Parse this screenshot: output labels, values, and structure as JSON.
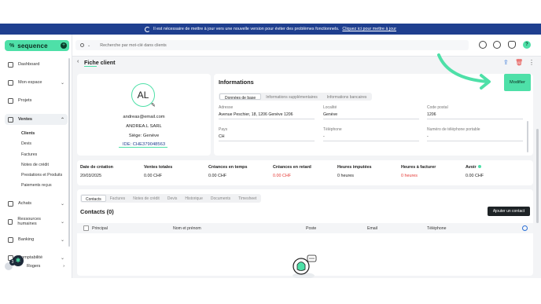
{
  "banner": {
    "text": "Il est nécessaire de mettre à jour vers une nouvelle version pour éviter des problèmes fonctionnels.",
    "link": "Cliquez ici pour mettre à jour"
  },
  "brand": {
    "name": "sequence",
    "mark": "%"
  },
  "sidebar": {
    "items": [
      {
        "label": "Dashboard",
        "icon": "home-icon"
      },
      {
        "label": "Mon espace",
        "icon": "user-icon"
      },
      {
        "label": "Projets",
        "icon": "checkbox-icon"
      },
      {
        "label": "Ventes",
        "icon": "flame-icon"
      },
      {
        "label": "Achats",
        "icon": "cart-icon"
      },
      {
        "label": "Ressources humaines",
        "icon": "people-icon"
      },
      {
        "label": "Banking",
        "icon": "bank-icon"
      },
      {
        "label": "Comptabilité",
        "icon": "calculator-icon"
      }
    ],
    "sub_items": [
      "Clients",
      "Devis",
      "Factures",
      "Notes de crédit",
      "Prestations et Produits",
      "Paiements reçus"
    ],
    "user_name": "Rogers",
    "badge": "3"
  },
  "topbar": {
    "search_placeholder": "Recherche par mot-clé dans clients",
    "help": "?"
  },
  "page": {
    "title": "Fiche client",
    "back": "‹"
  },
  "profile": {
    "initials": "AL",
    "email": "andreas@email.com",
    "company": "ANDREA.L SARL",
    "siege": "Siège: Genève",
    "ide": "IDE: CHE379048563"
  },
  "info": {
    "title": "Informations",
    "modify_label": "Modifier",
    "tabs": [
      "Données de base",
      "Informations supplémentaires",
      "Informations bancaires"
    ],
    "fields": {
      "adresse_label": "Adresse",
      "adresse_value": "Avenue Peschier, 18, 1206 Genève 1206",
      "localite_label": "Localité",
      "localite_value": "Genève",
      "code_postal_label": "Code postal",
      "code_postal_value": "1206",
      "pays_label": "Pays",
      "pays_value": "CH",
      "telephone_label": "Téléphone",
      "telephone_value": "-",
      "portable_label": "Numéro de téléphone portable",
      "portable_value": "-"
    }
  },
  "stats": [
    {
      "label": "Date de création",
      "value": "20/03/2025"
    },
    {
      "label": "Ventes totales",
      "value": "0.00 CHF"
    },
    {
      "label": "Créances en temps",
      "value": "0.00 CHF"
    },
    {
      "label": "Créances en retard",
      "value": "0.00 CHF"
    },
    {
      "label": "Heures imputées",
      "value": "0 heures"
    },
    {
      "label": "Heures à facturer",
      "value": "0 heures"
    },
    {
      "label": "Avoir",
      "value": "0.00 CHF"
    }
  ],
  "contacts": {
    "tabs": [
      "Contacts",
      "Factures",
      "Notes de crédit",
      "Devis",
      "Historique",
      "Documents",
      "Timesheet"
    ],
    "title": "Contacts (0)",
    "add_label": "Ajouter un contact",
    "columns": [
      "Principal",
      "Nom et prénom",
      "Poste",
      "Email",
      "Téléphone"
    ]
  },
  "colors": {
    "accent": "#4ee0a8",
    "banner": "#1f3f8f",
    "danger": "#e53935",
    "dark": "#1e2326"
  }
}
